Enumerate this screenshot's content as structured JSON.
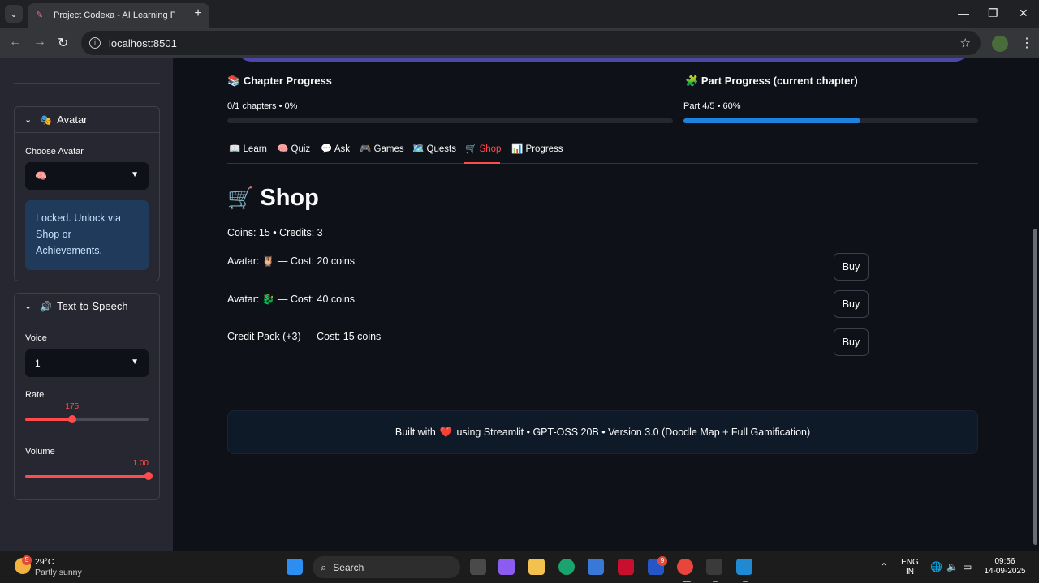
{
  "browser": {
    "tab_title": "Project Codexa - AI Learning Pl",
    "tab_close": "✕",
    "new_tab": "+",
    "url": "localhost:8501",
    "window_controls": [
      "—",
      "❐",
      "✕"
    ]
  },
  "sidebar": {
    "avatar_expander": {
      "title": "Avatar",
      "icon": "🎭",
      "choose_label": "Choose Avatar",
      "selected_avatar": "🧠",
      "locked_message": "Locked. Unlock via Shop or Achievements."
    },
    "tts_expander": {
      "title": "Text-to-Speech",
      "icon": "🔊",
      "voice_label": "Voice",
      "voice_value": "1",
      "rate_label": "Rate",
      "rate_value": "175",
      "rate_fraction": 0.38,
      "volume_label": "Volume",
      "volume_value": "1.00",
      "volume_fraction": 1.0
    }
  },
  "progress": {
    "chapter": {
      "icon": "📚",
      "title": "Chapter Progress",
      "text": "0/1 chapters • 0%",
      "fraction": 0.0
    },
    "part": {
      "icon": "🧩",
      "title": "Part Progress (current chapter)",
      "text": "Part 4/5 • 60%",
      "fraction": 0.6
    }
  },
  "tabs": [
    {
      "icon": "📖",
      "label": "Learn"
    },
    {
      "icon": "🧠",
      "label": "Quiz"
    },
    {
      "icon": "💬",
      "label": "Ask"
    },
    {
      "icon": "🎮",
      "label": "Games"
    },
    {
      "icon": "🗺️",
      "label": "Quests"
    },
    {
      "icon": "🛒",
      "label": "Shop"
    },
    {
      "icon": "📊",
      "label": "Progress"
    }
  ],
  "active_tab": "Shop",
  "shop": {
    "title_icon": "🛒",
    "title": "Shop",
    "balance": "Coins: 15 • Credits: 3",
    "items": [
      {
        "text": "Avatar: 🦉 — Cost: 20 coins",
        "button": "Buy"
      },
      {
        "text": "Avatar: 🐉 — Cost: 40 coins",
        "button": "Buy"
      },
      {
        "text": "Credit Pack (+3) — Cost: 15 coins",
        "button": "Buy"
      }
    ]
  },
  "footer": {
    "before": "Built with",
    "heart": "❤️",
    "after": "using Streamlit • GPT-OSS 20B • Version 3.0 (Doodle Map + Full Gamification)"
  },
  "taskbar": {
    "weather_temp": "29°C",
    "weather_desc": "Partly sunny",
    "weather_badge": "5",
    "search_placeholder": "Search",
    "teams_badge": "9",
    "lang_line1": "ENG",
    "lang_line2": "IN",
    "time": "09:56",
    "date": "14-09-2025"
  }
}
